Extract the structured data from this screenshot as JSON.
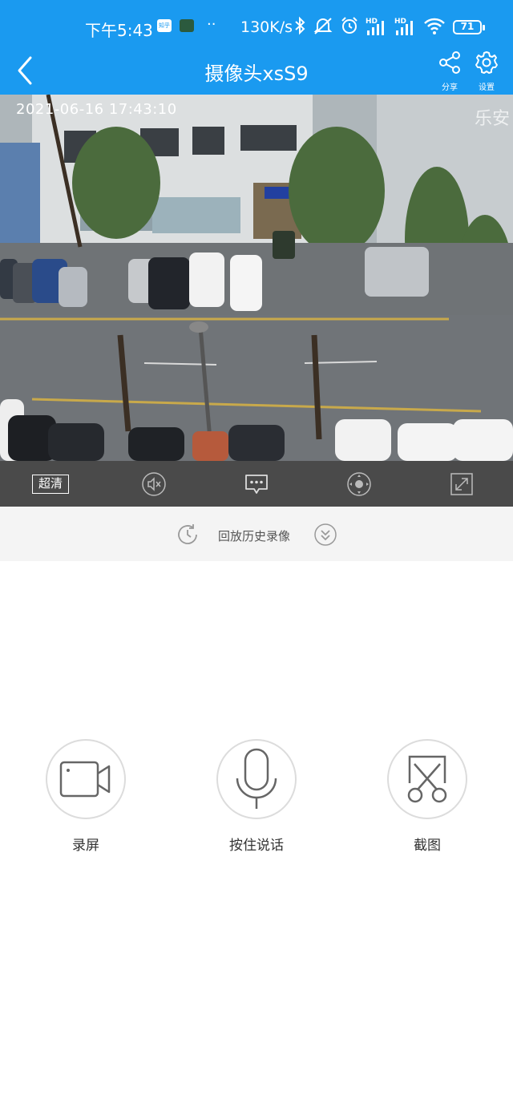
{
  "status_bar": {
    "time": "下午5:43",
    "net_speed": "130K/s",
    "battery": "71",
    "more_dots": "··",
    "app_icon_1": "知乎",
    "app_icon_2": "app-icon"
  },
  "header": {
    "title": "摄像头xsS9",
    "share_label": "分享",
    "settings_label": "设置",
    "bg_color": "#1a9af0"
  },
  "video": {
    "osd_timestamp": "2021-06-16 17:43:10",
    "osd_brand": "乐安"
  },
  "controls": {
    "quality_label": "超清",
    "icons": [
      "mute-icon",
      "message-icon",
      "ptz-icon",
      "fullscreen-icon"
    ]
  },
  "playback": {
    "label": "回放历史录像"
  },
  "actions": {
    "record_label": "录屏",
    "talk_label": "按住说话",
    "screenshot_label": "截图"
  }
}
